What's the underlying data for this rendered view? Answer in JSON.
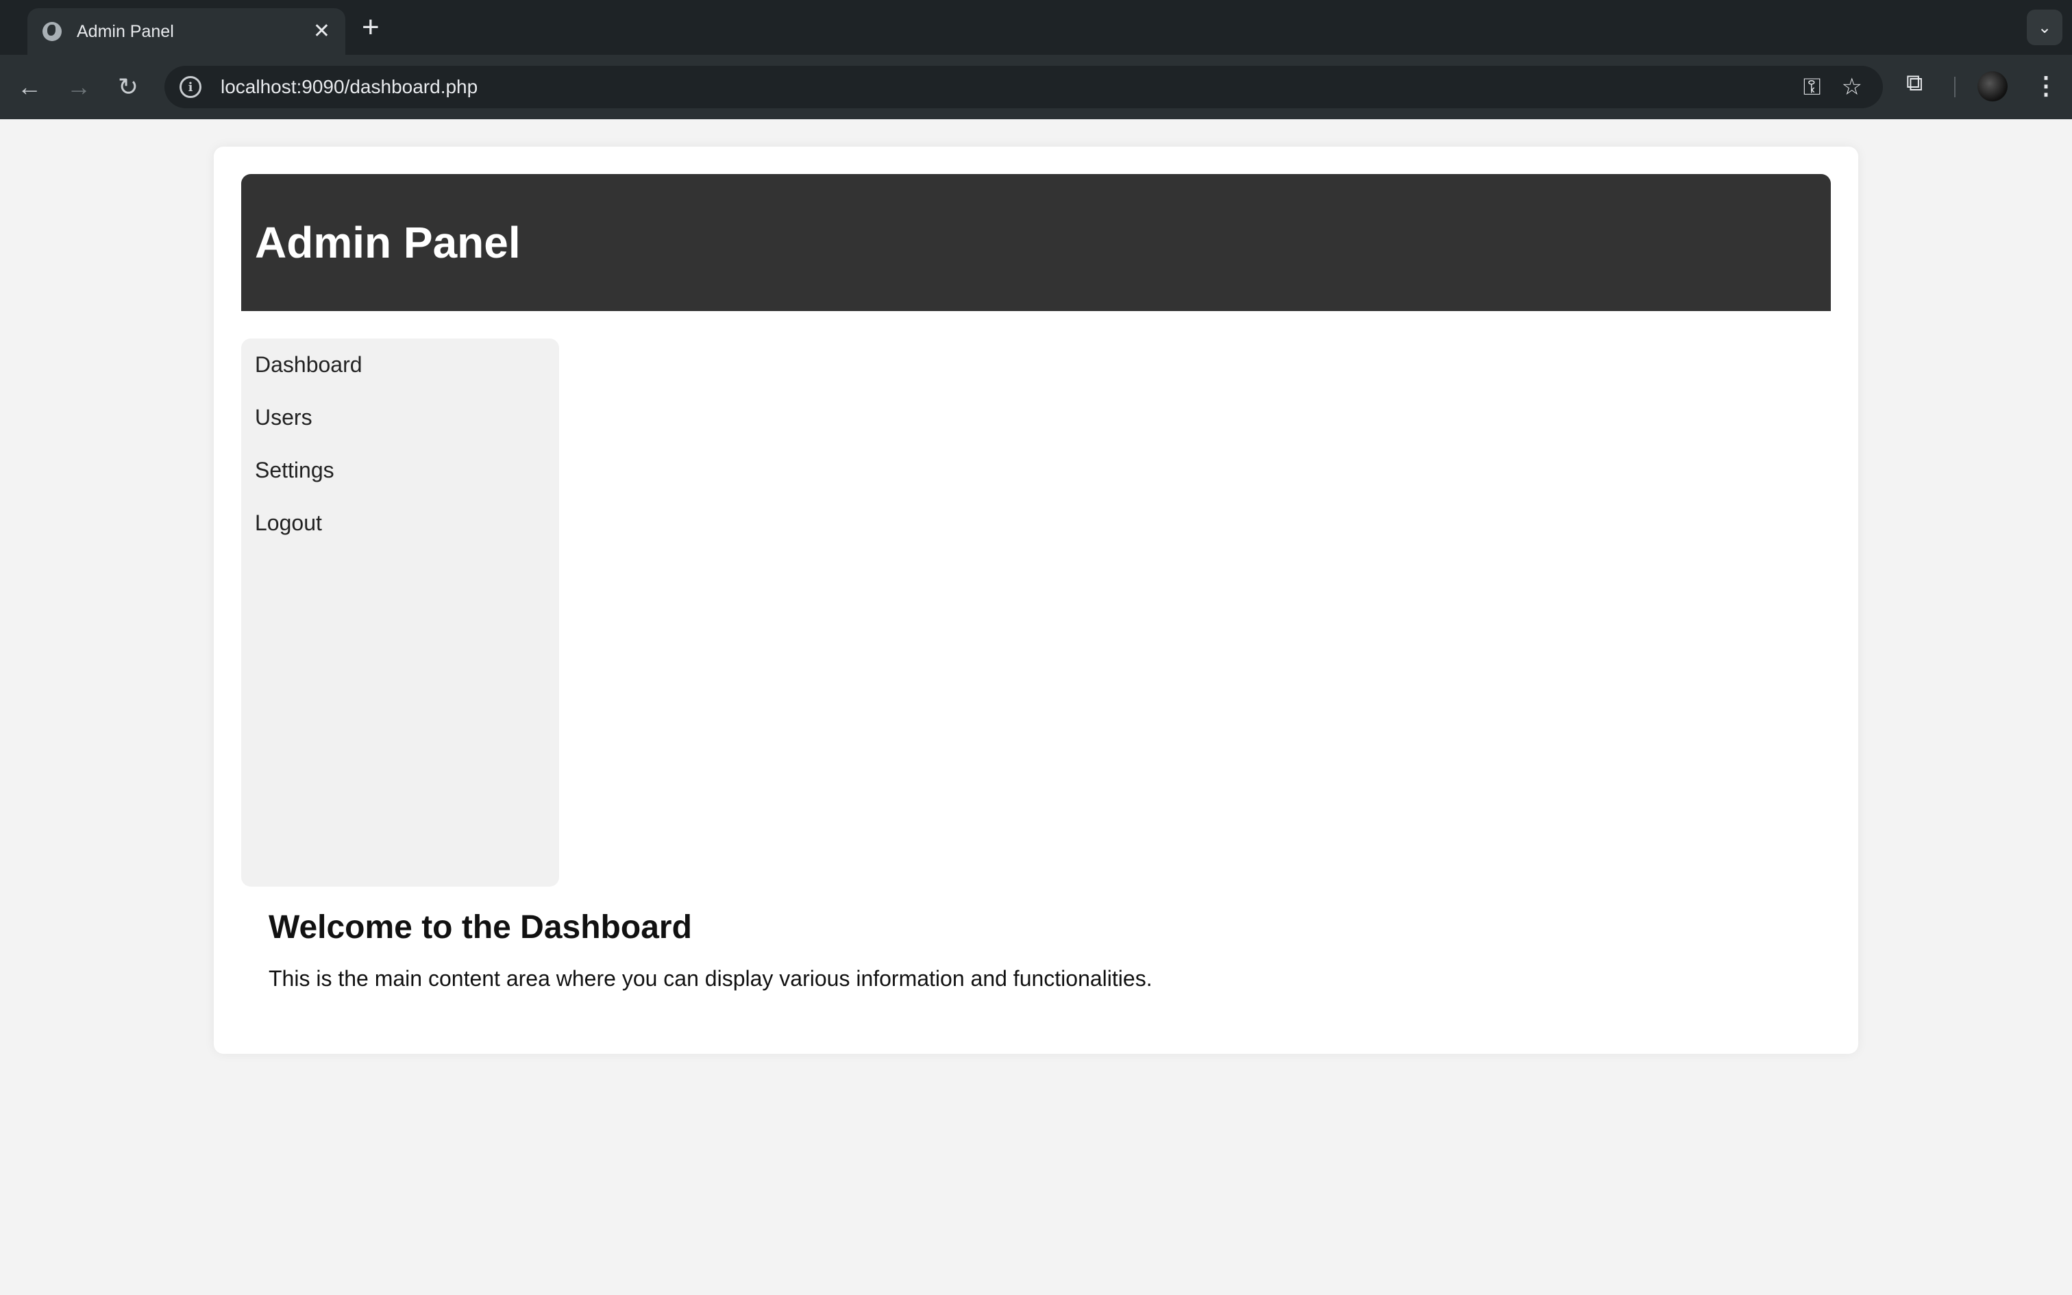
{
  "browser": {
    "tab_title": "Admin Panel",
    "tab_close": "✕",
    "new_tab": "+",
    "tab_menu": "⌄",
    "url": "localhost:9090/dashboard.php",
    "icons": {
      "back": "←",
      "forward": "→",
      "reload": "↻",
      "site_info": "i",
      "password_key": "⚿",
      "bookmark_star": "☆",
      "extensions": "⧉",
      "menu": "⋮"
    }
  },
  "page": {
    "header_title": "Admin Panel",
    "sidebar": {
      "items": [
        {
          "label": "Dashboard"
        },
        {
          "label": "Users"
        },
        {
          "label": "Settings"
        },
        {
          "label": "Logout"
        }
      ]
    },
    "main": {
      "heading": "Welcome to the Dashboard",
      "text": "This is the main content area where you can display various information and functionalities."
    }
  },
  "colors": {
    "header_bg": "#333333",
    "sidebar_bg": "#f1f1f1",
    "page_bg": "#f3f3f3",
    "card_bg": "#ffffff"
  }
}
